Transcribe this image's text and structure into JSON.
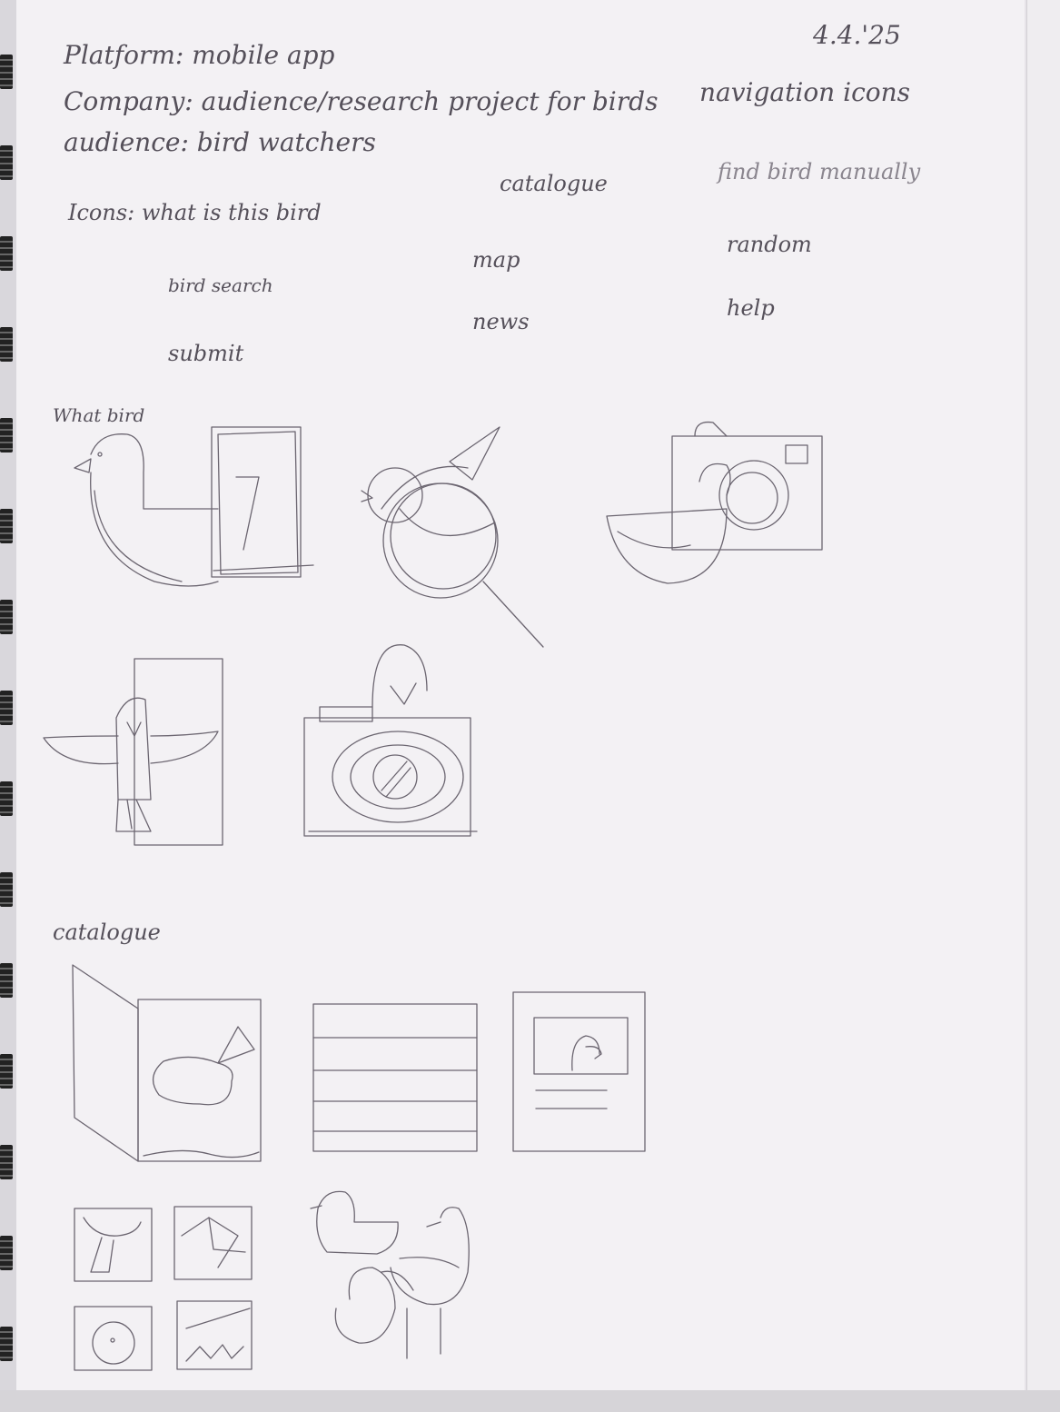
{
  "notes": {
    "date": "4.4.'25",
    "platform": "Platform: mobile app",
    "company": "Company: audience/research project for birds",
    "audience": "audience: bird watchers",
    "navigation_heading": "navigation icons",
    "icons_label": "Icons: what is this bird",
    "catalogue": "catalogue",
    "find_bird_manually": "find bird manually",
    "map": "map",
    "random": "random",
    "bird_search": "bird search",
    "news": "news",
    "help": "help",
    "submit": "submit",
    "what_bird_heading": "What bird",
    "catalogue_heading": "catalogue"
  },
  "sketches": [
    "bird-with-book-icon",
    "bird-magnifier-icon",
    "bird-camera-icon",
    "bird-in-frame-icon",
    "camera-with-bird-icon",
    "open-book-bird-icon",
    "list-rows-icon",
    "framed-bird-card-icon",
    "thumbnail-grid-icon",
    "bird-group-icon"
  ],
  "colors": {
    "paper": "#f3f1f4",
    "pencil": "#55505a",
    "pencil_faint": "#8a858e",
    "background": "#d9d7dc"
  }
}
